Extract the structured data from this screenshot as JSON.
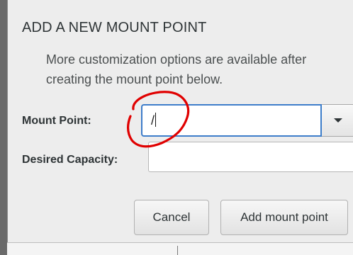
{
  "dialog": {
    "title": "ADD A NEW MOUNT POINT",
    "description": "More customization options are available after creating the mount point below.",
    "mount_point": {
      "label": "Mount Point:",
      "value": "/"
    },
    "desired_capacity": {
      "label": "Desired Capacity:",
      "value": ""
    },
    "buttons": {
      "cancel": "Cancel",
      "add": "Add mount point"
    }
  },
  "colors": {
    "focus_border": "#3d7dca",
    "annotation": "#e00000"
  },
  "icons": {
    "dropdown": "chevron-down-icon"
  }
}
